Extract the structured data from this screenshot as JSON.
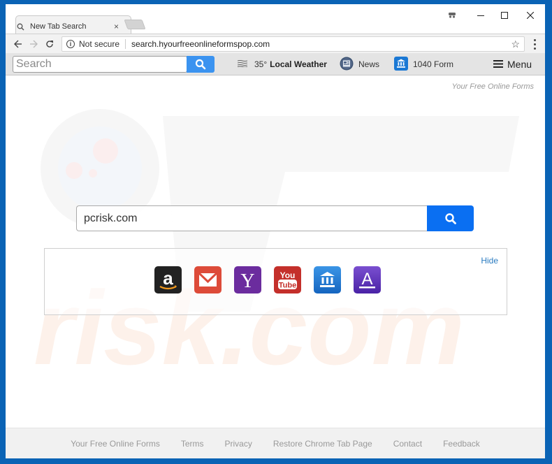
{
  "browser": {
    "tab_title": "New Tab Search",
    "address": "search.hyourfreeonlineformspop.com",
    "security_label": "Not secure"
  },
  "extension_toolbar": {
    "search_placeholder": "Search",
    "weather_temp": "35°",
    "weather_label": "Local Weather",
    "news_label": "News",
    "form_label": "1040 Form",
    "menu_label": "Menu"
  },
  "page": {
    "tagline": "Your Free Online Forms",
    "search_value": "pcrisk.com",
    "hide_label": "Hide",
    "shortcuts": [
      {
        "name": "Amazon",
        "icon": "amazon-icon",
        "color": "#222222"
      },
      {
        "name": "Gmail",
        "icon": "gmail-icon",
        "color": "#dd4b39"
      },
      {
        "name": "Yahoo",
        "icon": "yahoo-icon",
        "color": "#6b2c9e"
      },
      {
        "name": "YouTube",
        "icon": "youtube-icon",
        "color": "#c4302b"
      },
      {
        "name": "1040 Form",
        "icon": "bank-icon",
        "color": "#1f7fd6"
      },
      {
        "name": "Dictionary",
        "icon": "letter-a-icon",
        "color": "#5a2fb3"
      }
    ]
  },
  "footer": {
    "links": [
      "Your Free Online Forms",
      "Terms",
      "Privacy",
      "Restore Chrome Tab Page",
      "Contact",
      "Feedback"
    ]
  },
  "colors": {
    "accent": "#0a6ff2",
    "toolbar_button": "#3b93f0",
    "link": "#2a7bc0"
  }
}
